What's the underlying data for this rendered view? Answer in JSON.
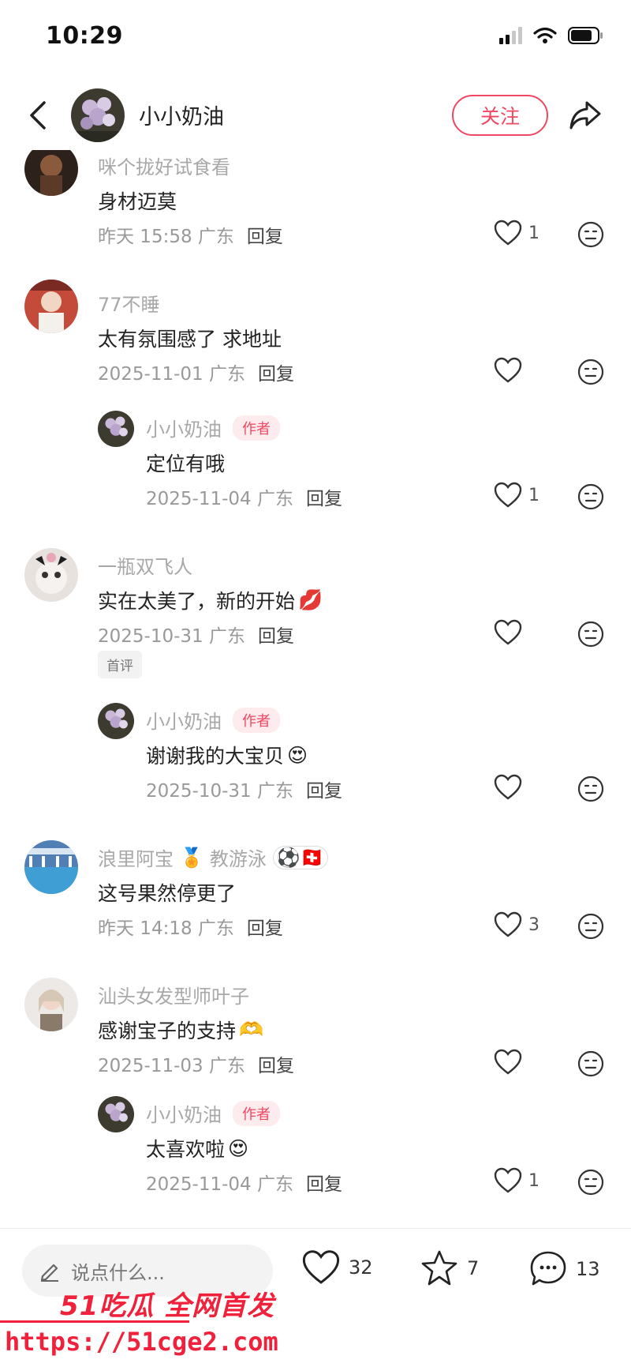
{
  "status_bar": {
    "time": "10:29"
  },
  "header": {
    "author_name": "小小奶油",
    "follow_label": "关注"
  },
  "comments": [
    {
      "author": "咪个拢好试食看",
      "text": "身材迈莫",
      "time": "昨天 15:58 广东",
      "reply_label": "回复",
      "likes": "1"
    },
    {
      "author": "77不睡",
      "text": "太有氛围感了 求地址",
      "time": "2025-11-01 广东",
      "reply_label": "回复",
      "likes": ""
    },
    {
      "author": "小小奶油",
      "tag": "作者",
      "text": "定位有哦",
      "time": "2025-11-04 广东",
      "reply_label": "回复",
      "likes": "1"
    },
    {
      "author": "一瓶双飞人",
      "text": "实在太美了，新的开始",
      "emoji": "💋",
      "time": "2025-10-31 广东",
      "reply_label": "回复",
      "likes": "",
      "badge": "首评"
    },
    {
      "author": "小小奶油",
      "tag": "作者",
      "text": "谢谢我的大宝贝",
      "emoji": "😍",
      "time": "2025-10-31 广东",
      "reply_label": "回复",
      "likes": ""
    },
    {
      "author": "浪里阿宝",
      "author_emoji": "🏅",
      "author_suffix": "教游泳",
      "author_suffix_emoji": "⚽🇨🇭",
      "text": "这号果然停更了",
      "time": "昨天 14:18 广东",
      "reply_label": "回复",
      "likes": "3"
    },
    {
      "author": "汕头女发型师叶子",
      "text": "感谢宝子的支持",
      "emoji": "🫶",
      "time": "2025-11-03 广东",
      "reply_label": "回复",
      "likes": ""
    },
    {
      "author": "小小奶油",
      "tag": "作者",
      "text": "太喜欢啦",
      "emoji": "😍",
      "time": "2025-11-04 广东",
      "reply_label": "回复",
      "likes": "1"
    }
  ],
  "bottom_bar": {
    "input_placeholder": "说点什么...",
    "likes": "32",
    "favorites": "7",
    "comments": "13"
  },
  "watermark": {
    "line1": "51吃瓜 全网首发",
    "line2": "https://51cge2.com"
  },
  "colors": {
    "accent": "#f04862",
    "watermark": "#f0213a"
  }
}
